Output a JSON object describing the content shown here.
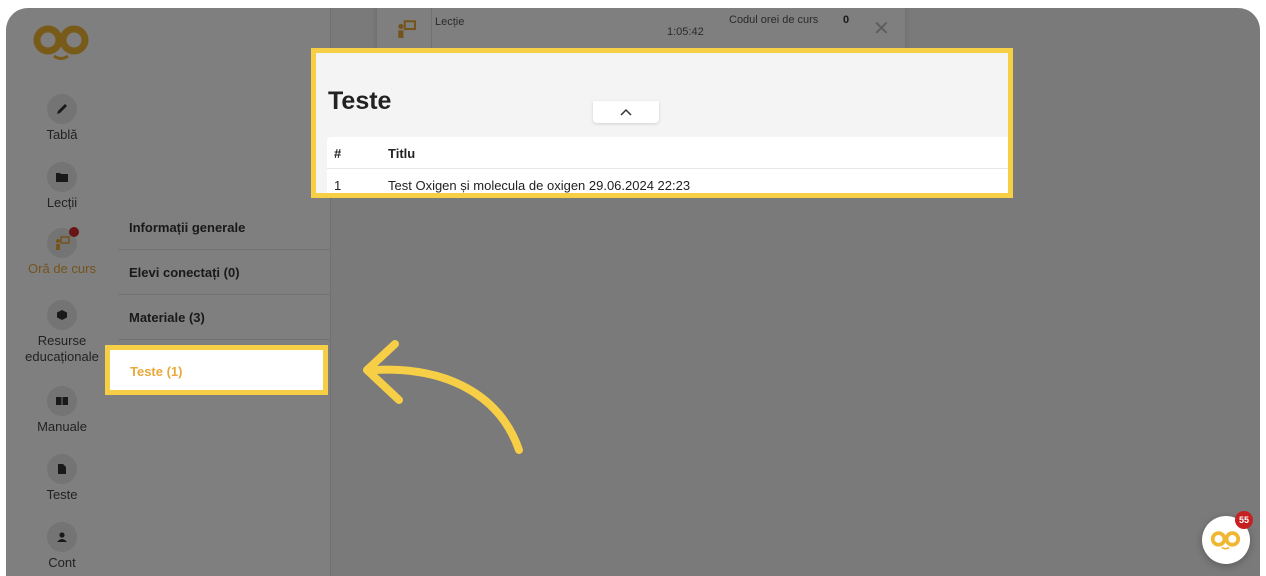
{
  "nav": {
    "items": [
      {
        "label": "Tablă",
        "icon": "pencil-icon"
      },
      {
        "label": "Lecții",
        "icon": "folder-icon"
      },
      {
        "label": "Oră de curs",
        "icon": "classroom-icon",
        "active": true
      },
      {
        "label": "Resurse educaționale",
        "icon": "cube-icon"
      },
      {
        "label": "Manuale",
        "icon": "book-icon"
      },
      {
        "label": "Teste",
        "icon": "file-icon"
      },
      {
        "label": "Cont",
        "icon": "user-icon"
      }
    ]
  },
  "panel": {
    "items": [
      {
        "label": "Informații generale"
      },
      {
        "label": "Elevi conectați (0)"
      },
      {
        "label": "Materiale (3)"
      },
      {
        "label": "Teste (1)",
        "active": true
      }
    ]
  },
  "lesson_card": {
    "type_label": "Lecție",
    "time": "1:05:42",
    "code_label": "Codul orei de curs",
    "code_value": "0"
  },
  "tests": {
    "title": "Teste",
    "columns": [
      "#",
      "Titlu"
    ],
    "rows": [
      {
        "num": "1",
        "title": "Test Oxigen și molecula de oxigen 29.06.2024 22:23"
      }
    ]
  },
  "help": {
    "badge": "55"
  },
  "colors": {
    "accent": "#e8a93a",
    "highlight": "#f7cf47",
    "badge": "#d12b2b"
  }
}
